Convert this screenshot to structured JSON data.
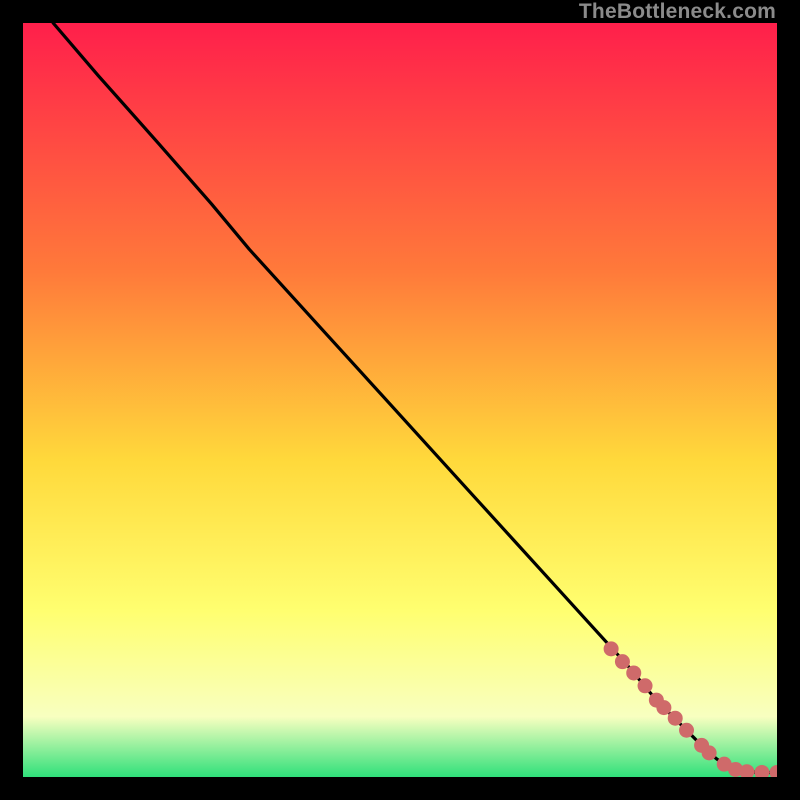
{
  "watermark": "TheBottleneck.com",
  "colors": {
    "gradient_top": "#ff1f4b",
    "gradient_mid1": "#ff7a3a",
    "gradient_mid2": "#ffd93b",
    "gradient_mid3": "#ffff70",
    "gradient_mid4": "#f8ffc0",
    "gradient_bottom": "#2fe07a",
    "line": "#000000",
    "marker": "#cf6a6a"
  },
  "chart_data": {
    "type": "line",
    "title": "",
    "xlabel": "",
    "ylabel": "",
    "xlim": [
      0,
      100
    ],
    "ylim": [
      0,
      100
    ],
    "series": [
      {
        "name": "curve",
        "x": [
          4,
          10,
          18,
          25,
          30,
          35,
          40,
          45,
          50,
          55,
          60,
          65,
          70,
          75,
          80,
          82,
          84,
          86,
          88,
          90,
          91,
          92,
          93,
          94,
          95,
          96,
          98,
          100
        ],
        "y": [
          100,
          93,
          84,
          76,
          70,
          64.5,
          59,
          53.5,
          48,
          42.5,
          37,
          31.5,
          26,
          20.5,
          15,
          12.6,
          10.2,
          8.2,
          6.2,
          4.2,
          3.2,
          2.4,
          1.7,
          1.2,
          0.9,
          0.7,
          0.6,
          0.6
        ]
      }
    ],
    "markers": {
      "name": "points",
      "x": [
        78,
        79.5,
        81,
        82.5,
        84,
        85,
        86.5,
        88,
        90,
        91,
        93,
        94.5,
        96,
        98,
        100
      ],
      "y": [
        17.0,
        15.3,
        13.8,
        12.1,
        10.2,
        9.2,
        7.8,
        6.2,
        4.2,
        3.2,
        1.7,
        1.0,
        0.7,
        0.6,
        0.6
      ]
    }
  }
}
